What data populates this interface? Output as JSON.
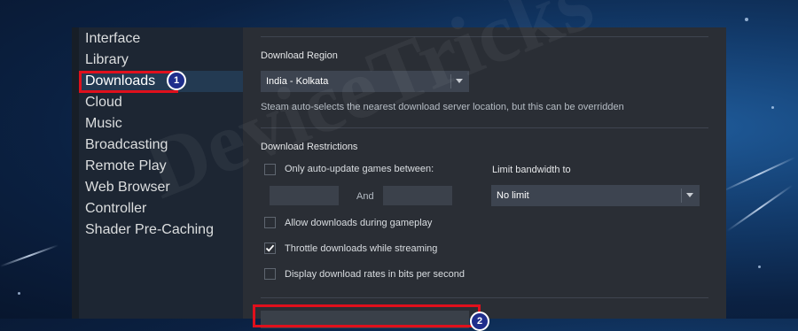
{
  "watermark": "DeviceTricks",
  "sidebar": {
    "items": [
      {
        "label": "Interface"
      },
      {
        "label": "Library"
      },
      {
        "label": "Downloads"
      },
      {
        "label": "Cloud"
      },
      {
        "label": "Music"
      },
      {
        "label": "Broadcasting"
      },
      {
        "label": "Remote Play"
      },
      {
        "label": "Web Browser"
      },
      {
        "label": "Controller"
      },
      {
        "label": "Shader Pre-Caching"
      }
    ],
    "active_label": "Downloads"
  },
  "annotations": {
    "badge1": "1",
    "badge2": "2"
  },
  "download_region": {
    "heading": "Download Region",
    "selected": "India - Kolkata",
    "hint": "Steam auto-selects the nearest download server location, but this can be overridden"
  },
  "restrictions": {
    "heading": "Download Restrictions",
    "only_auto_update_label": "Only auto-update games between:",
    "and_label": "And",
    "limit_bandwidth_label": "Limit bandwidth to",
    "bandwidth_selected": "No limit"
  },
  "options": [
    {
      "label": "Allow downloads during gameplay",
      "checked": false
    },
    {
      "label": "Throttle downloads while streaming",
      "checked": true
    },
    {
      "label": "Display download rates in bits per second",
      "checked": false
    }
  ]
}
